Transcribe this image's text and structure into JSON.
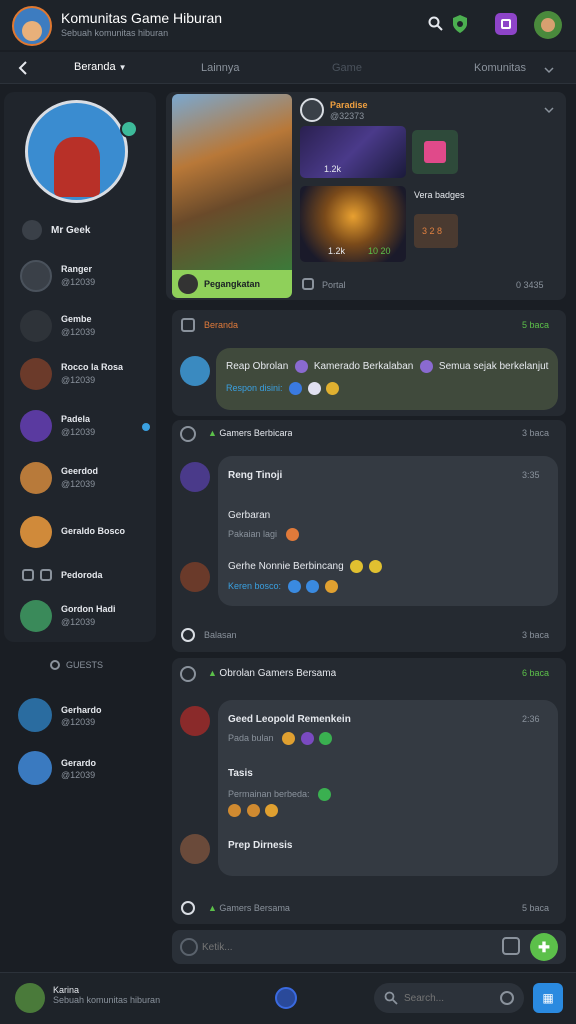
{
  "header": {
    "title": "Komunitas Game Hiburan",
    "subtitle": "Sebuah komunitas hiburan"
  },
  "tabs": [
    {
      "label": "Beranda",
      "active": true
    },
    {
      "label": "Lainnya",
      "active": false
    },
    {
      "label": "Game",
      "active": false
    },
    {
      "label": "Komunitas",
      "active": false
    }
  ],
  "sidebar": {
    "profile_name": "Mr Geek",
    "items": [
      {
        "name": "Ranger",
        "meta": "@12039"
      },
      {
        "name": "Gembe",
        "meta": "@12039"
      },
      {
        "name": "Rocco la Rosa",
        "meta": "@12039"
      },
      {
        "name": "Padela",
        "meta": "@12039"
      },
      {
        "name": "Geerdod",
        "meta": "@12039"
      },
      {
        "name": "Geraldo Bosco"
      },
      {
        "name": "Pedoroda"
      },
      {
        "name": "Gordon Hadi",
        "meta": "@12039"
      }
    ],
    "section_title": "GUESTS",
    "guests": [
      {
        "name": "Gerhardo",
        "meta": "@12039"
      },
      {
        "name": "Gerardo",
        "meta": "@12039"
      }
    ]
  },
  "featured": {
    "username": "Paradise",
    "handle": "@32373",
    "banner_label": "Pegangkatan",
    "footer_label": "Portal",
    "footer_meta": "0 3435",
    "thumb1_meta": "1.2k",
    "thumb2_count": "1.2k",
    "thumb2_stats": "10 20",
    "side_label": "Vera badges",
    "tile_label": "3 2 8"
  },
  "posts": [
    {
      "header_label": "Beranda",
      "header_meta": "5 baca",
      "messages": [
        {
          "text": "Reap Obrolan",
          "text2": "Kamerado Berkalaban",
          "text3": "Semua sejak berkelanjut",
          "reply": "Respon disini:"
        }
      ]
    },
    {
      "header_label": "Gamers Berbicara",
      "header_meta": "3 baca",
      "messages": [
        {
          "title": "Reng Tinoji",
          "time": "3:35",
          "text": "Gerbaran",
          "sub": "Pakaian lagi"
        },
        {
          "title": "Gerhe Nonnie Berbincang",
          "reply": "Keren bosco:"
        }
      ],
      "footer_label": "Balasan",
      "footer_meta": "3 baca"
    },
    {
      "header_label": "Obrolan Gamers Bersama",
      "header_meta": "6 baca",
      "messages": [
        {
          "title": "Geed Leopold Remenkein",
          "time": "2:36",
          "sub": "Pada bulan"
        },
        {
          "title": "Tasis",
          "sub": "Permainan berbeda:"
        },
        {
          "title": "Prep Dirnesis"
        }
      ],
      "footer_label": "Gamers Bersama",
      "footer_meta": "5 baca"
    }
  ],
  "composer": {
    "placeholder": "Ketik..."
  },
  "bottom": {
    "user_name": "Karina",
    "user_status": "Sebuah komunitas hiburan",
    "search_placeholder": "Search..."
  },
  "colors": {
    "accent": "#5cc04a",
    "background": "#1a1e24",
    "card": "#252a31",
    "bubble": "#343a42"
  }
}
